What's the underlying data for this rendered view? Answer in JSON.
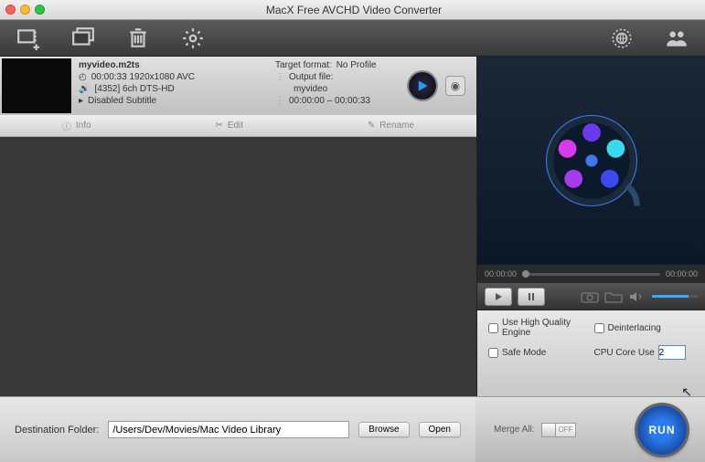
{
  "titlebar": {
    "title": "MacX Free AVCHD Video Converter"
  },
  "file": {
    "name": "myvideo.m2ts",
    "video_line": "00:00:33 1920x1080 AVC",
    "audio_line": "[4352] 6ch DTS-HD",
    "subtitle_line": "Disabled Subtitle",
    "target_format_label": "Target format:",
    "target_format_value": "No Profile",
    "output_label": "Output file:",
    "output_value": "myvideo",
    "duration": "00:00:00 – 00:00:33"
  },
  "actions": {
    "info": "Info",
    "edit": "Edit",
    "rename": "Rename"
  },
  "preview": {
    "time_start": "00:00:00",
    "time_end": "00:00:00"
  },
  "options": {
    "hq": "Use High Quality Engine",
    "deint": "Deinterlacing",
    "safe": "Safe Mode",
    "core_label": "CPU Core Use",
    "core_value": "2"
  },
  "merge": {
    "label": "Merge All:",
    "state": "OFF"
  },
  "run": "RUN",
  "dest": {
    "label": "Destination Folder:",
    "path": "/Users/Dev/Movies/Mac Video Library",
    "browse": "Browse",
    "open": "Open"
  }
}
